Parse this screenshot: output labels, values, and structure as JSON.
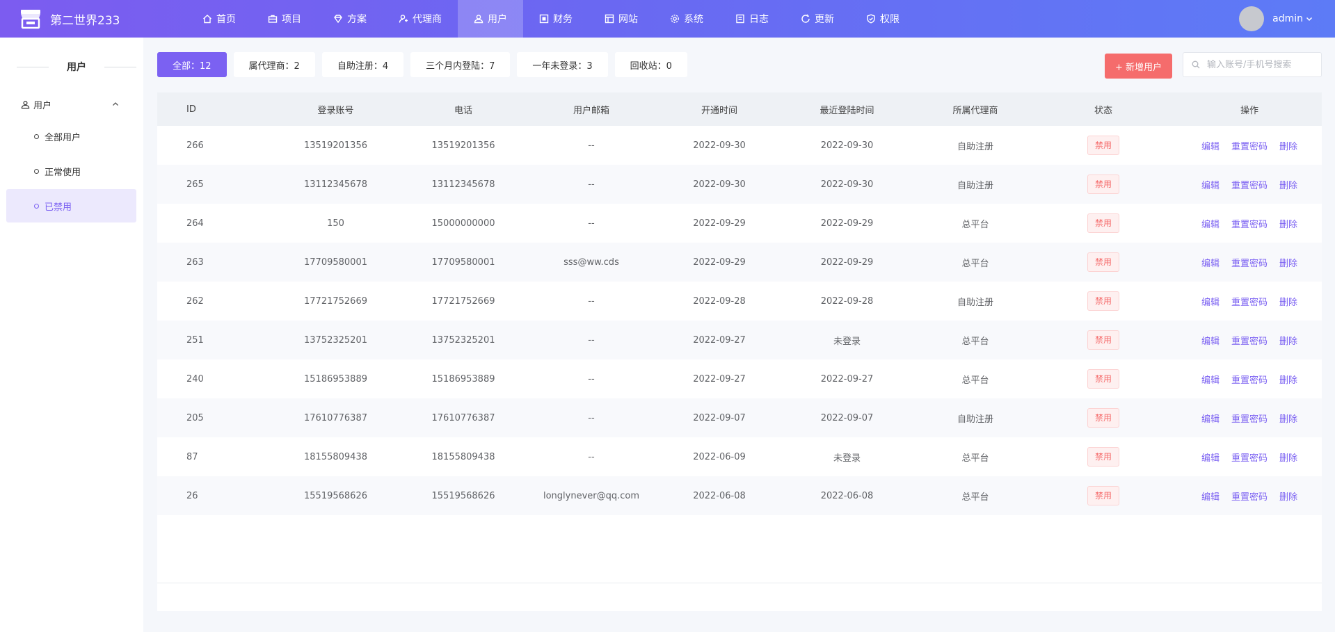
{
  "header": {
    "brand": "第二世界233",
    "nav": [
      {
        "label": "首页",
        "icon": "home-icon"
      },
      {
        "label": "项目",
        "icon": "briefcase-icon"
      },
      {
        "label": "方案",
        "icon": "diamond-icon"
      },
      {
        "label": "代理商",
        "icon": "agent-icon"
      },
      {
        "label": "用户",
        "icon": "user-icon",
        "active": true
      },
      {
        "label": "财务",
        "icon": "finance-icon"
      },
      {
        "label": "网站",
        "icon": "website-icon"
      },
      {
        "label": "系统",
        "icon": "gear-icon"
      },
      {
        "label": "日志",
        "icon": "log-icon"
      },
      {
        "label": "更新",
        "icon": "refresh-icon"
      },
      {
        "label": "权限",
        "icon": "shield-icon"
      }
    ],
    "user": {
      "name": "admin"
    }
  },
  "sidebar": {
    "title": "用户",
    "group": {
      "label": "用户"
    },
    "items": [
      {
        "label": "全部用户"
      },
      {
        "label": "正常使用"
      },
      {
        "label": "已禁用",
        "active": true
      }
    ]
  },
  "filters": [
    {
      "label": "全部：12",
      "active": true
    },
    {
      "label": "属代理商：2"
    },
    {
      "label": "自助注册：4"
    },
    {
      "label": "三个月内登陆：7"
    },
    {
      "label": "一年未登录：3"
    },
    {
      "label": "回收站：0"
    }
  ],
  "actions": {
    "add_user": "+ 新增用户",
    "search_placeholder": "输入账号/手机号搜索"
  },
  "table": {
    "columns": [
      "ID",
      "登录账号",
      "电话",
      "用户邮箱",
      "开通时间",
      "最近登陆时间",
      "所属代理商",
      "状态",
      "操作"
    ],
    "op_labels": [
      "编辑",
      "重置密码",
      "删除"
    ],
    "rows": [
      {
        "id": "266",
        "account": "13519201356",
        "phone": "13519201356",
        "email": "--",
        "opened": "2022-09-30",
        "last_login": "2022-09-30",
        "agent": "自助注册",
        "status": "禁用"
      },
      {
        "id": "265",
        "account": "13112345678",
        "phone": "13112345678",
        "email": "--",
        "opened": "2022-09-30",
        "last_login": "2022-09-30",
        "agent": "自助注册",
        "status": "禁用"
      },
      {
        "id": "264",
        "account": "150",
        "phone": "15000000000",
        "email": "--",
        "opened": "2022-09-29",
        "last_login": "2022-09-29",
        "agent": "总平台",
        "status": "禁用"
      },
      {
        "id": "263",
        "account": "17709580001",
        "phone": "17709580001",
        "email": "sss@ww.cds",
        "opened": "2022-09-29",
        "last_login": "2022-09-29",
        "agent": "总平台",
        "status": "禁用"
      },
      {
        "id": "262",
        "account": "17721752669",
        "phone": "17721752669",
        "email": "--",
        "opened": "2022-09-28",
        "last_login": "2022-09-28",
        "agent": "自助注册",
        "status": "禁用"
      },
      {
        "id": "251",
        "account": "13752325201",
        "phone": "13752325201",
        "email": "--",
        "opened": "2022-09-27",
        "last_login": "未登录",
        "agent": "总平台",
        "status": "禁用"
      },
      {
        "id": "240",
        "account": "15186953889",
        "phone": "15186953889",
        "email": "--",
        "opened": "2022-09-27",
        "last_login": "2022-09-27",
        "agent": "总平台",
        "status": "禁用"
      },
      {
        "id": "205",
        "account": "17610776387",
        "phone": "17610776387",
        "email": "--",
        "opened": "2022-09-07",
        "last_login": "2022-09-07",
        "agent": "自助注册",
        "status": "禁用"
      },
      {
        "id": "87",
        "account": "18155809438",
        "phone": "18155809438",
        "email": "--",
        "opened": "2022-06-09",
        "last_login": "未登录",
        "agent": "总平台",
        "status": "禁用"
      },
      {
        "id": "26",
        "account": "15519568626",
        "phone": "15519568626",
        "email": "longlynever@qq.com",
        "opened": "2022-06-08",
        "last_login": "2022-06-08",
        "agent": "总平台",
        "status": "禁用"
      }
    ]
  },
  "colors": {
    "accent": "#7b61f2",
    "danger": "#f56c6c",
    "header_gradient_start": "#7c5cf0",
    "header_gradient_end": "#5d7bf6"
  }
}
